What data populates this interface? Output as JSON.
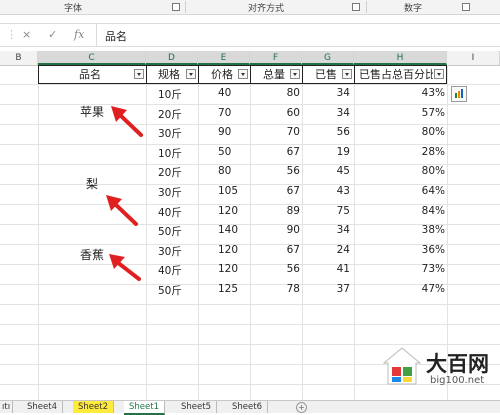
{
  "ribbon": {
    "groups": [
      {
        "label": "字体"
      },
      {
        "label": "对齐方式"
      },
      {
        "label": "数字"
      }
    ]
  },
  "formula_bar": {
    "cancel_icon": "×",
    "confirm_icon": "✓",
    "fx_label": "fx",
    "content": "品名"
  },
  "columns": [
    "B",
    "C",
    "D",
    "E",
    "F",
    "G",
    "H",
    "I"
  ],
  "table": {
    "headers": [
      "品名",
      "规格",
      "价格",
      "总量",
      "已售",
      "已售占总百分比"
    ],
    "fruits": [
      "苹果",
      "梨",
      "香蕉"
    ],
    "rows": [
      [
        "10斤",
        "40",
        "80",
        "34",
        "43%"
      ],
      [
        "20斤",
        "70",
        "60",
        "34",
        "57%"
      ],
      [
        "30斤",
        "90",
        "70",
        "56",
        "80%"
      ],
      [
        "10斤",
        "50",
        "67",
        "19",
        "28%"
      ],
      [
        "20斤",
        "80",
        "56",
        "45",
        "80%"
      ],
      [
        "30斤",
        "105",
        "67",
        "43",
        "64%"
      ],
      [
        "40斤",
        "120",
        "89",
        "75",
        "84%"
      ],
      [
        "50斤",
        "140",
        "90",
        "34",
        "38%"
      ],
      [
        "30斤",
        "120",
        "67",
        "24",
        "36%"
      ],
      [
        "40斤",
        "120",
        "56",
        "41",
        "73%"
      ],
      [
        "50斤",
        "125",
        "78",
        "37",
        "47%"
      ]
    ]
  },
  "sheet_tabs": [
    {
      "label": "Sheet4",
      "style": "normal"
    },
    {
      "label": "Sheet2",
      "style": "yellow"
    },
    {
      "label": "Sheet1",
      "style": "active"
    },
    {
      "label": "Sheet5",
      "style": "normal"
    },
    {
      "label": "Sheet6",
      "style": "normal"
    }
  ],
  "sheet_tab_partial": "ıtı",
  "watermark": {
    "title": "大百网",
    "url": "big100.net"
  },
  "colors": {
    "accent": "#217346",
    "arrow": "#e02020",
    "yellow_tab": "#ffeb3b"
  }
}
